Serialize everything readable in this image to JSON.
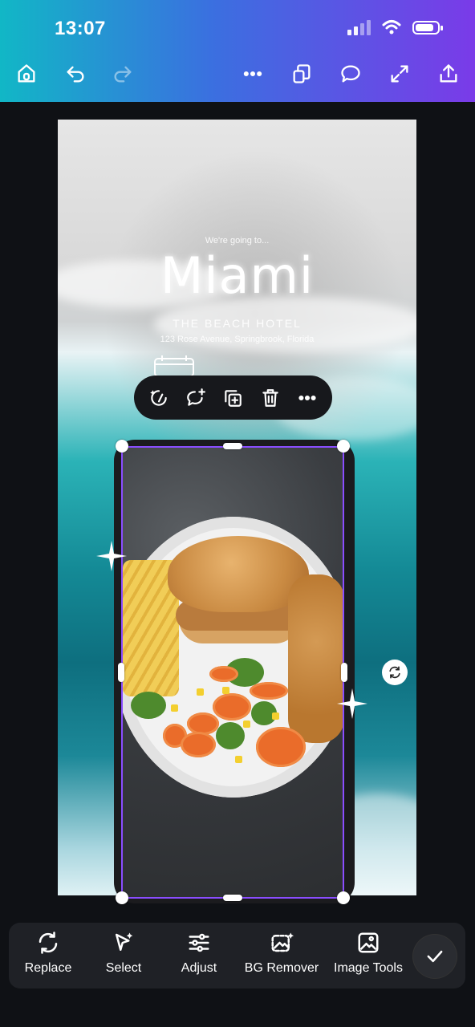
{
  "status_bar": {
    "time": "13:07"
  },
  "header": {
    "icons": [
      "home-icon",
      "undo-icon",
      "redo-icon",
      "more-icon",
      "pages-icon",
      "comment-icon",
      "fullscreen-icon",
      "share-icon"
    ]
  },
  "canvas": {
    "subtitle": "We're going to...",
    "title": "Miami",
    "hotel": "THE BEACH HOTEL",
    "address": "123 Rose Avenue, Springbrook, Florida"
  },
  "context_menu": {
    "icons": [
      "magic-edit-icon",
      "add-comment-icon",
      "duplicate-icon",
      "delete-icon",
      "more-icon"
    ]
  },
  "bottom_tools": {
    "items": [
      {
        "label": "Replace",
        "icon": "replace-icon"
      },
      {
        "label": "Select",
        "icon": "select-icon"
      },
      {
        "label": "Adjust",
        "icon": "adjust-icon"
      },
      {
        "label": "BG Remover",
        "icon": "bg-remover-icon"
      },
      {
        "label": "Image Tools",
        "icon": "image-tools-icon"
      }
    ],
    "done_icon": "checkmark-icon"
  },
  "colors": {
    "header_gradient_start": "#11b7c6",
    "header_gradient_end": "#7a3be8",
    "selection": "#8a4dff",
    "background": "#0f1115"
  }
}
